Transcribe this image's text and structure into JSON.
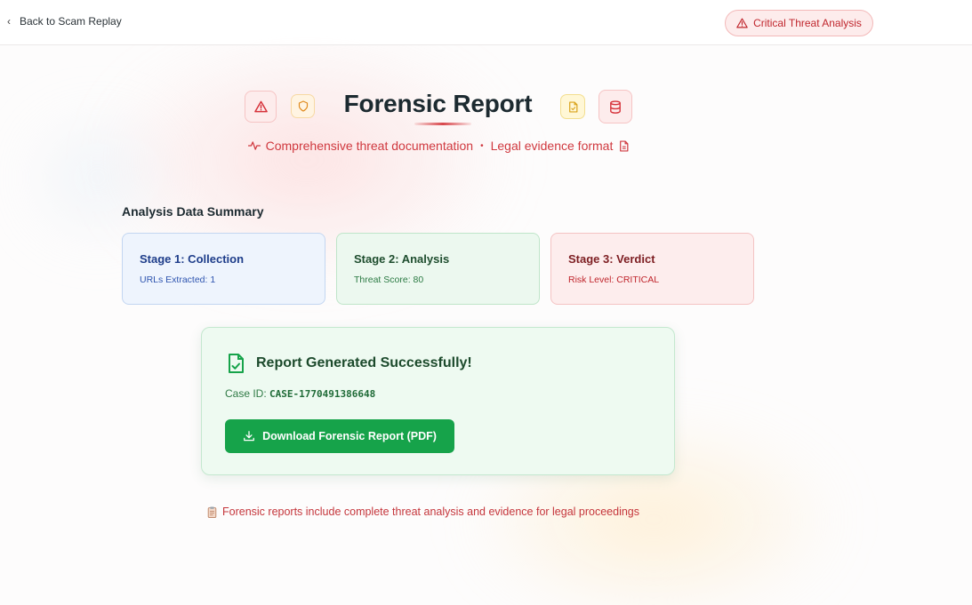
{
  "nav": {
    "back_label": "Back to Scam Replay",
    "threat_badge_label": "Critical Threat Analysis"
  },
  "header": {
    "title": "Forensic Report",
    "subtitle_left": "Comprehensive threat documentation",
    "separator": "•",
    "subtitle_right": "Legal evidence format",
    "icons": [
      "alert-triangle-icon",
      "shield-icon",
      "document-icon",
      "database-icon"
    ]
  },
  "summary": {
    "title": "Analysis Data Summary",
    "stages": [
      {
        "title": "Stage 1: Collection",
        "detail": "URLs Extracted: 1"
      },
      {
        "title": "Stage 2: Analysis",
        "detail": "Threat Score: 80"
      },
      {
        "title": "Stage 3: Verdict",
        "detail": "Risk Level: CRITICAL"
      }
    ]
  },
  "report": {
    "success_title": "Report Generated Successfully!",
    "case_label": "Case ID:",
    "case_id": "CASE-1770491386648",
    "download_label": "Download Forensic Report (PDF)"
  },
  "footer": {
    "note": "Forensic reports include complete threat analysis and evidence for legal proceedings"
  },
  "colors": {
    "critical_red": "#c0262d",
    "success_green": "#16a34a",
    "stage1_blue": "#1e3d8a",
    "stage2_green": "#1e4d2e",
    "stage3_red": "#7d1e22"
  }
}
